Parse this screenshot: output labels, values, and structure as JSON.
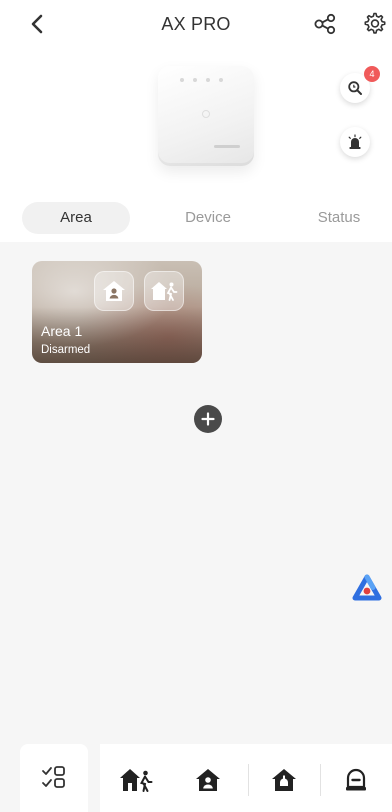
{
  "header": {
    "title": "AX PRO"
  },
  "device_panel": {
    "alert_badge_count": "4"
  },
  "tabs": [
    {
      "label": "Area",
      "active": true
    },
    {
      "label": "Device",
      "active": false
    },
    {
      "label": "Status",
      "active": false
    }
  ],
  "areas": [
    {
      "name": "Area 1",
      "state": "Disarmed"
    }
  ],
  "bottom_bar": {
    "icons": [
      "multi-select-icon",
      "away-arm-icon",
      "stay-arm-icon",
      "disarm-icon",
      "clear-alarm-icon"
    ]
  },
  "colors": {
    "accent_red": "#f05a5a",
    "icon_dark": "#333333",
    "logo_blue": "#2f6fe0",
    "logo_red": "#e04040"
  }
}
